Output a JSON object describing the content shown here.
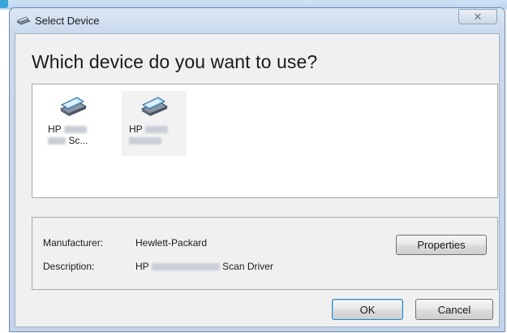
{
  "window": {
    "title": "Select Device",
    "close_glyph": "✕"
  },
  "main": {
    "instruction": "Which device do you want to use?",
    "devices": [
      {
        "line1": "HP",
        "line2": "Sc...",
        "icon": "scanner-icon"
      },
      {
        "line1": "HP",
        "line2": "",
        "icon": "scanner-icon"
      }
    ]
  },
  "info": {
    "manufacturer_label": "Manufacturer:",
    "manufacturer_value": "Hewlett-Packard",
    "description_label": "Description:",
    "description_prefix": "HP",
    "description_suffix": "Scan Driver",
    "properties_button": "Properties"
  },
  "footer": {
    "ok_button": "OK",
    "cancel_button": "Cancel"
  },
  "colors": {
    "title_gradient_top": "#dbe8f6",
    "title_gradient_bottom": "#c3d4ea",
    "default_button_border": "#3c7fb1"
  }
}
